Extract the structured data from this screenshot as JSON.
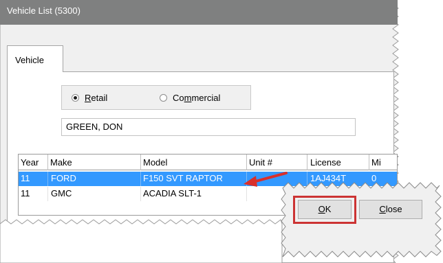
{
  "window": {
    "title": "Vehicle List (5300)"
  },
  "tabs": [
    {
      "label": "Vehicle"
    }
  ],
  "customer_type": {
    "options": [
      {
        "label": "Retail",
        "accel": "R",
        "rest": "etail",
        "selected": true
      },
      {
        "label": "Commercial",
        "pre": "Co",
        "accel": "m",
        "rest": "mercial",
        "selected": false
      }
    ]
  },
  "customer_name": "GREEN, DON",
  "table": {
    "columns": [
      "Year",
      "Make",
      "Model",
      "Unit #",
      "License",
      "Mi"
    ],
    "rows": [
      {
        "year": "11",
        "make": "FORD",
        "model": "F150 SVT RAPTOR",
        "unit": "",
        "license": "1AJ434T",
        "mi": "0",
        "selected": true
      },
      {
        "year": "11",
        "make": "GMC",
        "model": "ACADIA SLT-1",
        "unit": "",
        "license": "",
        "mi": "",
        "selected": false
      }
    ]
  },
  "buttons": {
    "ok": {
      "accel": "O",
      "rest": "K"
    },
    "close": {
      "accel": "C",
      "rest": "lose"
    }
  },
  "colors": {
    "title_bar": "#7f8080",
    "selection": "#3399ff",
    "highlight_box": "#cc3333",
    "arrow": "#d9302b"
  }
}
